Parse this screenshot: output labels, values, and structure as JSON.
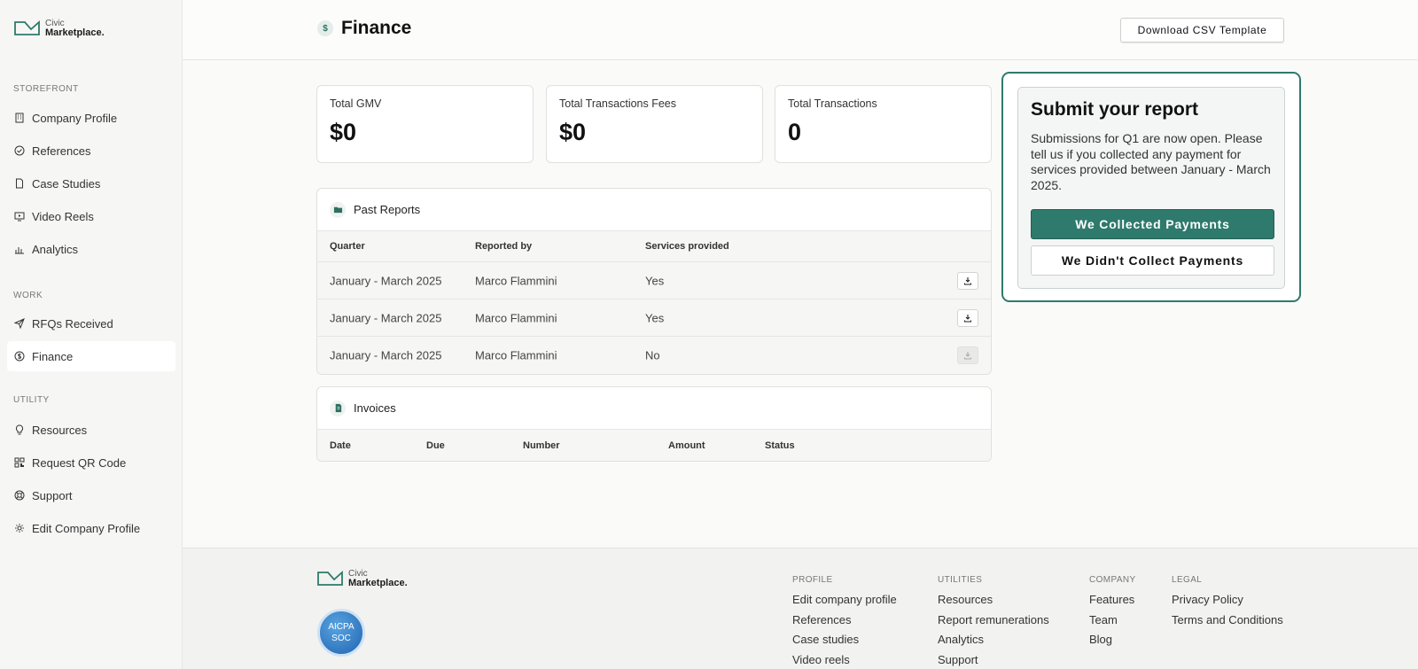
{
  "brand": {
    "line1": "Civic",
    "line2": "Marketplace."
  },
  "sidebar": {
    "sections": [
      {
        "title": "STOREFRONT",
        "items": [
          {
            "label": "Company Profile",
            "icon": "building-icon"
          },
          {
            "label": "References",
            "icon": "check-circle-icon"
          },
          {
            "label": "Case Studies",
            "icon": "document-icon"
          },
          {
            "label": "Video Reels",
            "icon": "video-icon"
          },
          {
            "label": "Analytics",
            "icon": "bar-chart-icon"
          }
        ]
      },
      {
        "title": "WORK",
        "items": [
          {
            "label": "RFQs Received",
            "icon": "send-icon"
          },
          {
            "label": "Finance",
            "icon": "dollar-circle-icon",
            "active": true
          }
        ]
      },
      {
        "title": "UTILITY",
        "items": [
          {
            "label": "Resources",
            "icon": "lightbulb-icon"
          },
          {
            "label": "Request QR Code",
            "icon": "qr-code-icon"
          },
          {
            "label": "Support",
            "icon": "lifebuoy-icon"
          },
          {
            "label": "Edit Company Profile",
            "icon": "gear-icon"
          }
        ]
      }
    ]
  },
  "header": {
    "title": "Finance",
    "csv_button": "Download CSV Template"
  },
  "stats": [
    {
      "label": "Total GMV",
      "value": "$0"
    },
    {
      "label": "Total Transactions Fees",
      "value": "$0"
    },
    {
      "label": "Total Transactions",
      "value": "0"
    }
  ],
  "past_reports": {
    "title": "Past Reports",
    "columns": [
      "Quarter",
      "Reported by",
      "Services provided"
    ],
    "rows": [
      {
        "quarter": "January - March 2025",
        "reported_by": "Marco Flammini",
        "services": "Yes",
        "download_enabled": true
      },
      {
        "quarter": "January - March 2025",
        "reported_by": "Marco Flammini",
        "services": "Yes",
        "download_enabled": true
      },
      {
        "quarter": "January - March 2025",
        "reported_by": "Marco Flammini",
        "services": "No",
        "download_enabled": false
      }
    ]
  },
  "invoices": {
    "title": "Invoices",
    "columns": [
      "Date",
      "Due",
      "Number",
      "Amount",
      "Status"
    ]
  },
  "report": {
    "title": "Submit your report",
    "text": "Submissions for Q1 are now open. Please tell us if you collected any payment for services provided between January - March 2025.",
    "primary_button": "We Collected Payments",
    "secondary_button": "We Didn't Collect Payments"
  },
  "footer": {
    "badge": {
      "line1": "AICPA",
      "line2": "SOC"
    },
    "columns": [
      {
        "title": "PROFILE",
        "links": [
          "Edit company profile",
          "References",
          "Case studies",
          "Video reels"
        ]
      },
      {
        "title": "UTILITIES",
        "links": [
          "Resources",
          "Report remunerations",
          "Analytics",
          "Support"
        ]
      },
      {
        "title": "COMPANY",
        "links": [
          "Features",
          "Team",
          "Blog"
        ]
      },
      {
        "title": "LEGAL",
        "links": [
          "Privacy Policy",
          "Terms and Conditions"
        ]
      }
    ]
  },
  "colors": {
    "accent": "#2e7a6c",
    "sidebar_bg": "#f6f6f5"
  }
}
